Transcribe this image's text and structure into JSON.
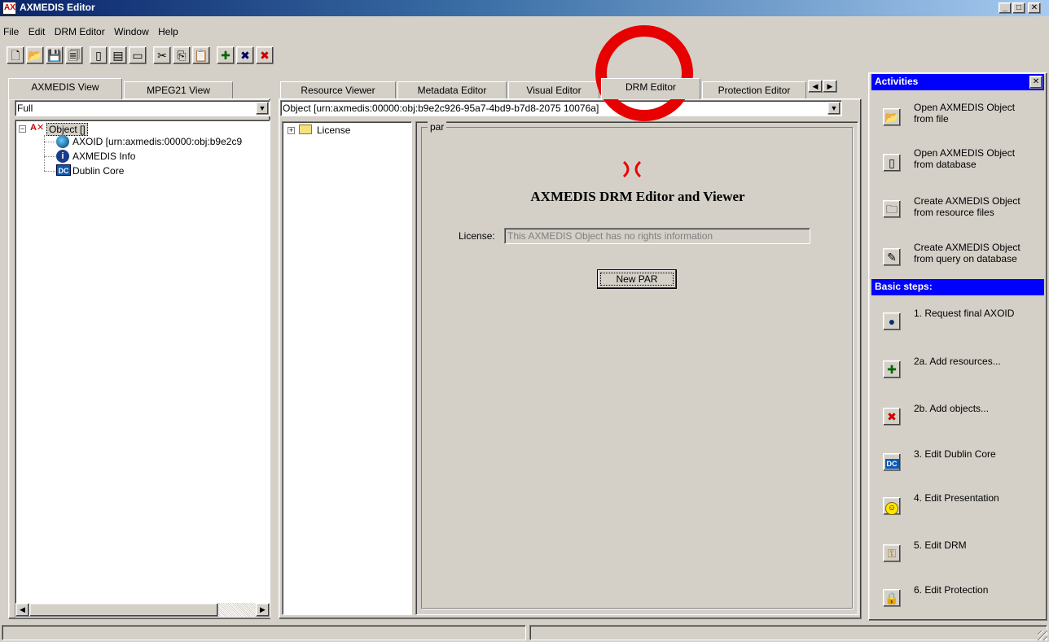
{
  "window": {
    "title": "AXMEDIS Editor",
    "minimize": "_",
    "maximize": "□",
    "close": "✕"
  },
  "menu": [
    "File",
    "Edit",
    "DRM Editor",
    "Window",
    "Help"
  ],
  "toolbar": {
    "icons": [
      "new-icon",
      "open-icon",
      "save-icon",
      "save-as-icon",
      "database-icon",
      "database-save-icon",
      "window-icon",
      "cut-icon",
      "copy-icon",
      "paste-icon",
      "add-resource-icon",
      "add-object-icon",
      "add-object-alt-icon"
    ]
  },
  "left_panel": {
    "tabs": [
      "AXMEDIS View",
      "MPEG21 View"
    ],
    "filter_value": "Full",
    "tree": {
      "root": "Object []",
      "children": [
        "AXOID [urn:axmedis:00000:obj:b9e2c9",
        "AXMEDIS Info",
        "Dublin Core"
      ]
    }
  },
  "editor_tabs": [
    "Resource Viewer",
    "Metadata Editor",
    "Visual Editor",
    "DRM Editor",
    "Protection Editor"
  ],
  "object_select": "Object [urn:axmedis:00000:obj:b9e2c926-95a7-4bd9-b7d8-2075 10076a]",
  "drm": {
    "tree_item": "License",
    "group_label": "par",
    "heading": "AXMEDIS DRM Editor and Viewer",
    "license_label": "License:",
    "license_value": "This AXMEDIS Object has no rights information",
    "new_par_button": "New PAR"
  },
  "activities": {
    "title": "Activities",
    "close": "✕",
    "items": [
      {
        "label": "Open AXMEDIS Object\nfrom file",
        "icon": "open-folder-icon"
      },
      {
        "label": "Open AXMEDIS Object\nfrom database",
        "icon": "database-icon"
      },
      {
        "label": "Create AXMEDIS Object\nfrom resource files",
        "icon": "new-folder-icon"
      },
      {
        "label": "Create AXMEDIS Object\nfrom query on database",
        "icon": "query-icon"
      }
    ],
    "basic_steps_title": "Basic steps:",
    "steps": [
      {
        "label": "1. Request final AXOID",
        "icon": "globe-icon"
      },
      {
        "label": "2a. Add resources...",
        "icon": "add-resources-icon"
      },
      {
        "label": "2b. Add objects...",
        "icon": "add-objects-icon"
      },
      {
        "label": "3. Edit Dublin Core",
        "icon": "dublin-core-icon"
      },
      {
        "label": "4. Edit Presentation",
        "icon": "smiley-icon"
      },
      {
        "label": "5. Edit DRM",
        "icon": "drm-icon"
      },
      {
        "label": "6. Edit Protection",
        "icon": "protection-icon"
      }
    ]
  },
  "colors": {
    "titlebar_start": "#0a246a",
    "titlebar_end": "#a6caf0",
    "section_header": "#0000ff",
    "highlight_circle": "#e60000"
  }
}
